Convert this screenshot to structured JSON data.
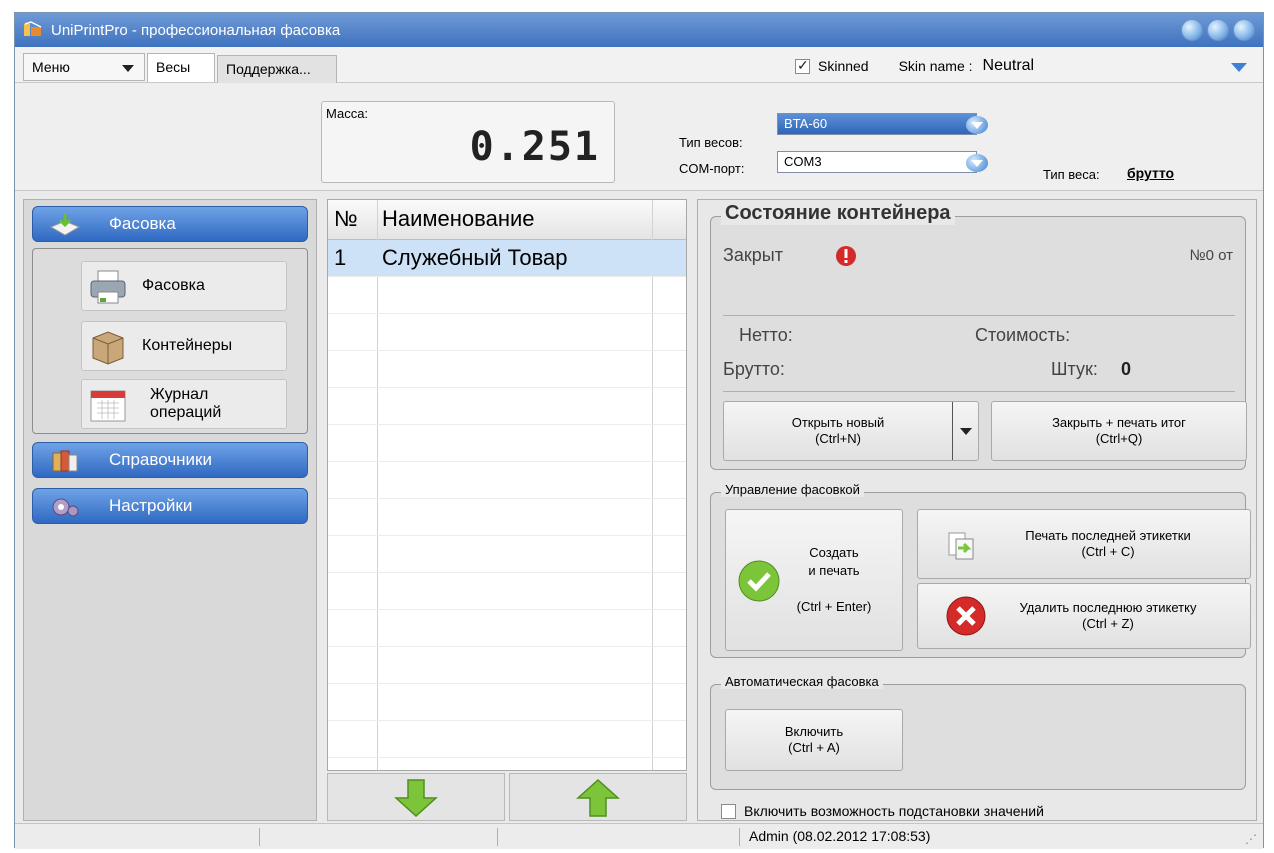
{
  "window": {
    "title": "UniPrintPro - профессиональная фасовка"
  },
  "tabs": {
    "menu": "Меню",
    "items": [
      "Весы",
      "Поддержка..."
    ]
  },
  "skin": {
    "skinned_label": "Skinned",
    "skinned_checked": true,
    "name_label": "Skin name :",
    "name_value": "Neutral"
  },
  "scale": {
    "mass_label": "Масса:",
    "mass_value": "0.251",
    "type_label": "Тип весов:",
    "type_value": "BTA-60",
    "port_label": "COM-порт:",
    "port_value": "COM3",
    "weight_type_label": "Тип веса:",
    "weight_type_value": "брутто"
  },
  "sidebar": {
    "sections": [
      "Фасовка",
      "Справочники",
      "Настройки"
    ],
    "items": [
      "Фасовка",
      "Контейнеры"
    ],
    "journal_line1": "Журнал",
    "journal_line2": "операций"
  },
  "products": {
    "headers": [
      "№",
      "Наименование"
    ],
    "rows": [
      {
        "num": "1",
        "name": "Служебный Товар"
      }
    ]
  },
  "container": {
    "title": "Состояние контейнера",
    "status": "Закрыт",
    "number": "№0 от",
    "netto_label": "Нетто:",
    "cost_label": "Стоимость:",
    "brutto_label": "Брутто:",
    "pieces_label": "Штук:",
    "pieces_value": "0",
    "open_line1": "Открыть новый",
    "open_line2": "(Ctrl+N)",
    "close_line1": "Закрыть + печать итог",
    "close_line2": "(Ctrl+Q)"
  },
  "packing": {
    "title": "Управление фасовкой",
    "create_line1": "Создать",
    "create_line2": "и печать",
    "create_line3": "(Ctrl + Enter)",
    "print_line1": "Печать последней этикетки",
    "print_line2": "(Ctrl + C)",
    "delete_line1": "Удалить последнюю этикетку",
    "delete_line2": "(Ctrl + Z)"
  },
  "auto": {
    "title": "Автоматическая фасовка",
    "enable_line1": "Включить",
    "enable_line2": "(Ctrl + A)"
  },
  "substitution": {
    "label": "Включить возможность подстановки значений",
    "checked": false
  },
  "status": {
    "user": "Admin (08.02.2012 17:08:53)"
  },
  "colors": {
    "accent": "#3b74c8",
    "selected_row": "#cde2f7",
    "ok_green": "#7cc43a",
    "error_red": "#d42a2a"
  }
}
